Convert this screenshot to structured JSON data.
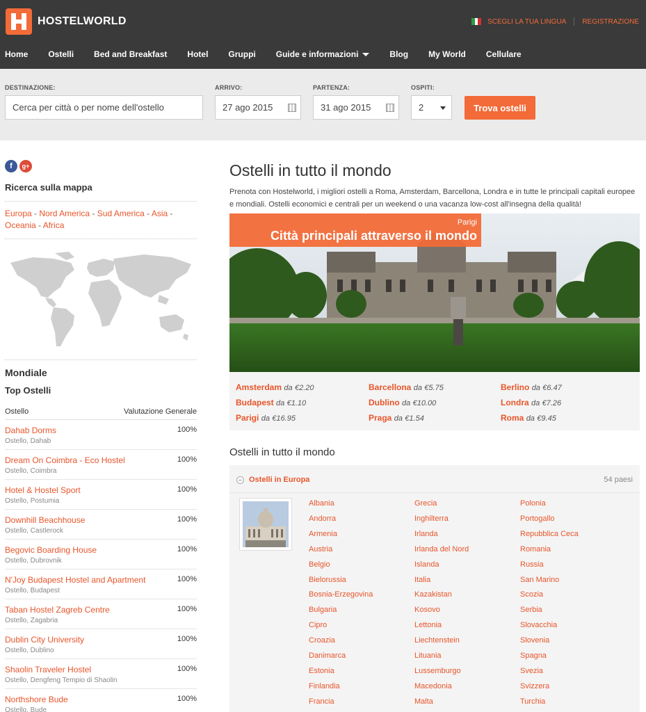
{
  "header": {
    "logo_text": "HOSTELWORLD",
    "lang_link": "SCEGLI LA TUA LINGUA",
    "register_link": "REGISTRAZIONE",
    "nav": [
      "Home",
      "Ostelli",
      "Bed and Breakfast",
      "Hotel",
      "Gruppi",
      "Guide e informazioni",
      "Blog",
      "My World",
      "Cellulare"
    ]
  },
  "search": {
    "destination_label": "DESTINAZIONE:",
    "destination_placeholder": "Cerca per città o per nome dell'ostello",
    "arrival_label": "ARRIVO:",
    "arrival_value": "27 ago 2015",
    "departure_label": "PARTENZA:",
    "departure_value": "31 ago 2015",
    "guests_label": "OSPITI:",
    "guests_value": "2",
    "find_button": "Trova ostelli"
  },
  "sidebar": {
    "map_search_title": "Ricerca sulla mappa",
    "continents": [
      "Europa",
      "Nord America",
      "Sud America",
      "Asia",
      "Oceania",
      "Africa"
    ],
    "world_title": "Mondiale",
    "top_hostels_title": "Top Ostelli",
    "col_hostel": "Ostello",
    "col_rating": "Valutazione Generale",
    "hostels": [
      {
        "name": "Dahab Dorms",
        "sub": "Ostello, Dahab",
        "rating": "100%"
      },
      {
        "name": "Dream On Coimbra - Eco Hostel",
        "sub": "Ostello, Coimbra",
        "rating": "100%"
      },
      {
        "name": "Hotel & Hostel Sport",
        "sub": "Ostello, Postumia",
        "rating": "100%"
      },
      {
        "name": "Downhill Beachhouse",
        "sub": "Ostello, Castlerock",
        "rating": "100%"
      },
      {
        "name": "Begovic Boarding House",
        "sub": "Ostello, Dubrovnik",
        "rating": "100%"
      },
      {
        "name": "N'Joy Budapest Hostel and Apartment",
        "sub": "Ostello, Budapest",
        "rating": "100%"
      },
      {
        "name": "Taban Hostel Zagreb Centre",
        "sub": "Ostello, Zagabria",
        "rating": "100%"
      },
      {
        "name": "Dublin City University",
        "sub": "Ostello, Dublino",
        "rating": "100%"
      },
      {
        "name": "Shaolin Traveler Hostel",
        "sub": "Ostello, Dengfeng Tempio di Shaolin",
        "rating": "100%"
      },
      {
        "name": "Northshore Bude",
        "sub": "Ostello, Bude",
        "rating": "100%"
      }
    ]
  },
  "main": {
    "title": "Ostelli in tutto il mondo",
    "description": "Prenota con Hostelworld, i migliori ostelli a Roma, Amsterdam, Barcellona, Londra e in tutte le principali capitali europee e mondiali. Ostelli economici e centrali per un weekend o una vacanza low-cost all'insegna della qualità!",
    "hero_city": "Parigi",
    "hero_title": "Città principali attraverso il mondo",
    "prefix": "da",
    "cities": [
      {
        "city": "Amsterdam",
        "price": "€2.20"
      },
      {
        "city": "Barcellona",
        "price": "€5.75"
      },
      {
        "city": "Berlino",
        "price": "€6.47"
      },
      {
        "city": "Budapest",
        "price": "€1.10"
      },
      {
        "city": "Dublino",
        "price": "€10.00"
      },
      {
        "city": "Londra",
        "price": "€7.26"
      },
      {
        "city": "Parigi",
        "price": "€16.95"
      },
      {
        "city": "Praga",
        "price": "€1.54"
      },
      {
        "city": "Roma",
        "price": "€9.45"
      }
    ],
    "world_section_title": "Ostelli in tutto il mondo",
    "europe_title": "Ostelli in Europa",
    "europe_count": "54 paesi",
    "countries_col1": [
      "Albania",
      "Andorra",
      "Armenia",
      "Austria",
      "Belgio",
      "Bielorussia",
      "Bosnia-Erzegovina",
      "Bulgaria",
      "Cipro",
      "Croazia",
      "Danimarca",
      "Estonia",
      "Finlandia",
      "Francia"
    ],
    "countries_col2": [
      "Grecia",
      "Inghilterra",
      "Irlanda",
      "Irlanda del Nord",
      "Islanda",
      "Italia",
      "Kazakistan",
      "Kosovo",
      "Lettonia",
      "Liechtenstein",
      "Lituania",
      "Lussemburgo",
      "Macedonia",
      "Malta"
    ],
    "countries_col3": [
      "Polonia",
      "Portogallo",
      "Repubblica Ceca",
      "Romania",
      "Russia",
      "San Marino",
      "Scozia",
      "Serbia",
      "Slovacchia",
      "Slovenia",
      "Spagna",
      "Svezia",
      "Svizzera",
      "Turchia"
    ]
  },
  "colors": {
    "accent": "#f26b38",
    "header_bg": "#3a3a3a",
    "link": "#e8552a"
  }
}
